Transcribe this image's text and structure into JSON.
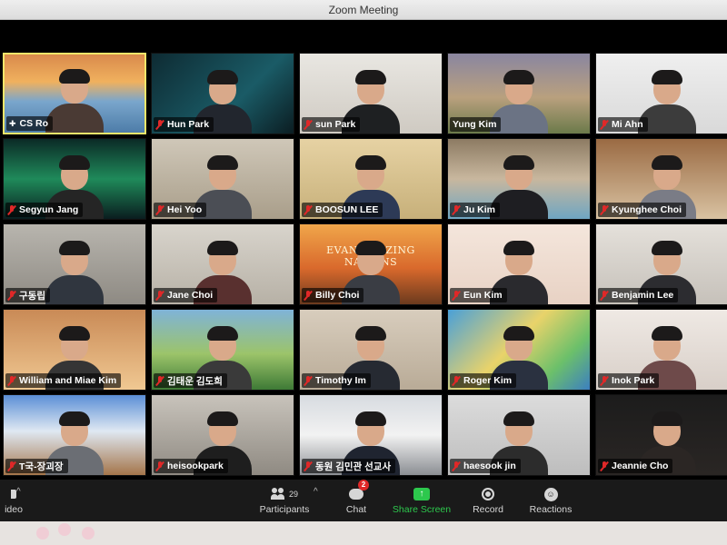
{
  "window": {
    "title": "Zoom Meeting"
  },
  "participants": [
    {
      "name": "CS Ro",
      "status": "pinned",
      "active": true
    },
    {
      "name": "Hun Park",
      "status": "muted"
    },
    {
      "name": "sun Park",
      "status": "muted"
    },
    {
      "name": "Yung Kim",
      "status": "none"
    },
    {
      "name": "Mi Ahn",
      "status": "muted"
    },
    {
      "name": "Segyun Jang",
      "status": "muted"
    },
    {
      "name": "Hei Yoo",
      "status": "muted"
    },
    {
      "name": "BOOSUN LEE",
      "status": "muted"
    },
    {
      "name": "Ju Kim",
      "status": "muted"
    },
    {
      "name": "Kyunghee Choi",
      "status": "muted"
    },
    {
      "name": "구동립",
      "status": "muted"
    },
    {
      "name": "Jane Choi",
      "status": "muted"
    },
    {
      "name": "Billy Choi",
      "status": "muted",
      "banner": "EVANGELIZING NATIONS"
    },
    {
      "name": "Eun Kim",
      "status": "muted"
    },
    {
      "name": "Benjamin Lee",
      "status": "muted"
    },
    {
      "name": "William and Miae Kim",
      "status": "muted"
    },
    {
      "name": "김태운 김도희",
      "status": "muted"
    },
    {
      "name": "Timothy Im",
      "status": "muted"
    },
    {
      "name": "Roger Kim",
      "status": "muted"
    },
    {
      "name": "Inok Park",
      "status": "muted"
    },
    {
      "name": "T국-장괴장",
      "status": "muted"
    },
    {
      "name": "heisookpark",
      "status": "muted"
    },
    {
      "name": "동원 김민관 선교사",
      "status": "muted"
    },
    {
      "name": "haesook jin",
      "status": "muted"
    },
    {
      "name": "Jeannie Cho",
      "status": "muted"
    }
  ],
  "toolbar": {
    "video_label": "ideo",
    "participants_label": "Participants",
    "participants_count": "29",
    "chat_label": "Chat",
    "chat_badge": "2",
    "share_label": "Share Screen",
    "record_label": "Record",
    "reactions_label": "Reactions"
  },
  "colors": {
    "share_green": "#2dc84d",
    "mute_red": "#e02828",
    "active_border": "#f0e66a"
  }
}
